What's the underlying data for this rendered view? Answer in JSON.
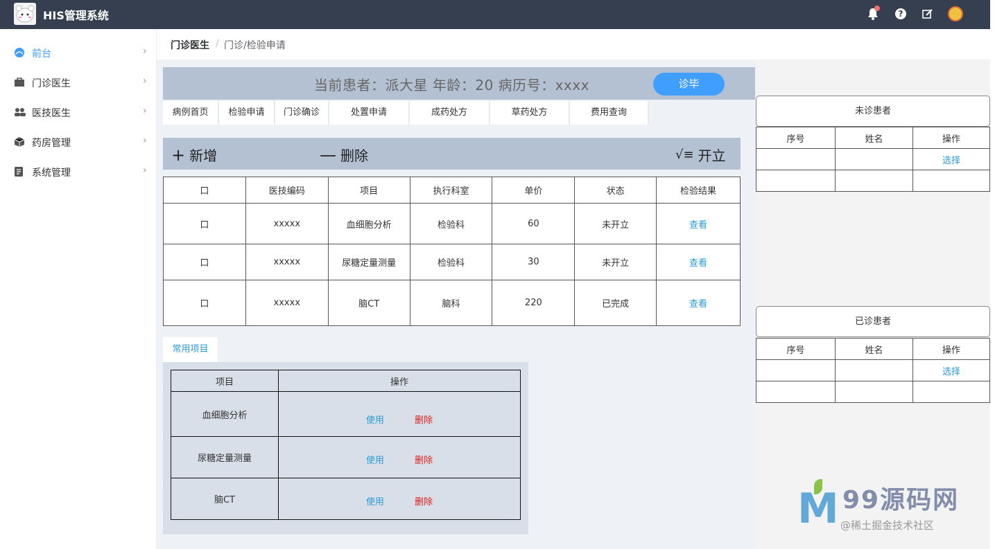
{
  "app": {
    "title": "HIS管理系统"
  },
  "topbar": {
    "icons": [
      "bell-icon",
      "help-icon",
      "edit-icon",
      "user-avatar"
    ],
    "help_label": "?"
  },
  "sidebar": {
    "items": [
      {
        "label": "前台",
        "icon": "dashboard-icon",
        "active": true
      },
      {
        "label": "门诊医生",
        "icon": "briefcase-icon"
      },
      {
        "label": "医技医生",
        "icon": "people-icon"
      },
      {
        "label": "药房管理",
        "icon": "box-icon"
      },
      {
        "label": "系统管理",
        "icon": "document-icon"
      }
    ],
    "chevron": "›"
  },
  "breadcrumb": {
    "root": "门诊医生",
    "separator": "/",
    "current": "门诊/检验申请"
  },
  "patient": {
    "info": "当前患者：派大星  年龄：20  病历号：xxxx",
    "finish_label": "诊毕"
  },
  "tabs": [
    "病例首页",
    "检验申请",
    "门诊确诊",
    "处置申请",
    "成药处方",
    "草药处方",
    "费用查询"
  ],
  "actions": {
    "add": {
      "glyph": "+",
      "label": "新增"
    },
    "delete": {
      "glyph": "—",
      "label": "删除"
    },
    "issue": {
      "glyph": "√≡",
      "label": "开立"
    }
  },
  "exam_table": {
    "headers": [
      "口",
      "医技编码",
      "项目",
      "执行科室",
      "单价",
      "状态",
      "检验结果"
    ],
    "rows": [
      {
        "check": "口",
        "code": "xxxxx",
        "item": "血细胞分析",
        "dept": "检验科",
        "price": "60",
        "status": "未开立",
        "result": "查看"
      },
      {
        "check": "口",
        "code": "xxxxx",
        "item": "尿糖定量测量",
        "dept": "检验科",
        "price": "30",
        "status": "未开立",
        "result": "查看"
      },
      {
        "check": "口",
        "code": "xxxxx",
        "item": "脑CT",
        "dept": "脑科",
        "price": "220",
        "status": "已完成",
        "result": "查看"
      }
    ]
  },
  "common": {
    "tab_label": "常用项目",
    "headers": [
      "项目",
      "操作"
    ],
    "rows": [
      {
        "item": "血细胞分析",
        "use": "使用",
        "delete": "删除"
      },
      {
        "item": "尿糖定量测量",
        "use": "使用",
        "delete": "删除"
      },
      {
        "item": "脑CT",
        "use": "使用",
        "delete": "删除"
      }
    ]
  },
  "unvisited": {
    "title": "未诊患者",
    "headers": [
      "序号",
      "姓名",
      "操作"
    ],
    "rows": [
      {
        "no": "",
        "name": "",
        "op": "选择"
      },
      {
        "no": "",
        "name": "",
        "op": ""
      }
    ]
  },
  "visited": {
    "title": "已诊患者",
    "headers": [
      "序号",
      "姓名",
      "操作"
    ],
    "rows": [
      {
        "no": "",
        "name": "",
        "op": "选择"
      },
      {
        "no": "",
        "name": "",
        "op": ""
      }
    ]
  },
  "watermark": {
    "logo_letter": "M",
    "brand": "99源码网",
    "sub": "@稀土掘金技术社区"
  },
  "colors": {
    "topbar": "#363f50",
    "accent": "#409eff",
    "link": "#2b9bd6",
    "danger": "#e02020",
    "panel": "#b4c1d2"
  }
}
